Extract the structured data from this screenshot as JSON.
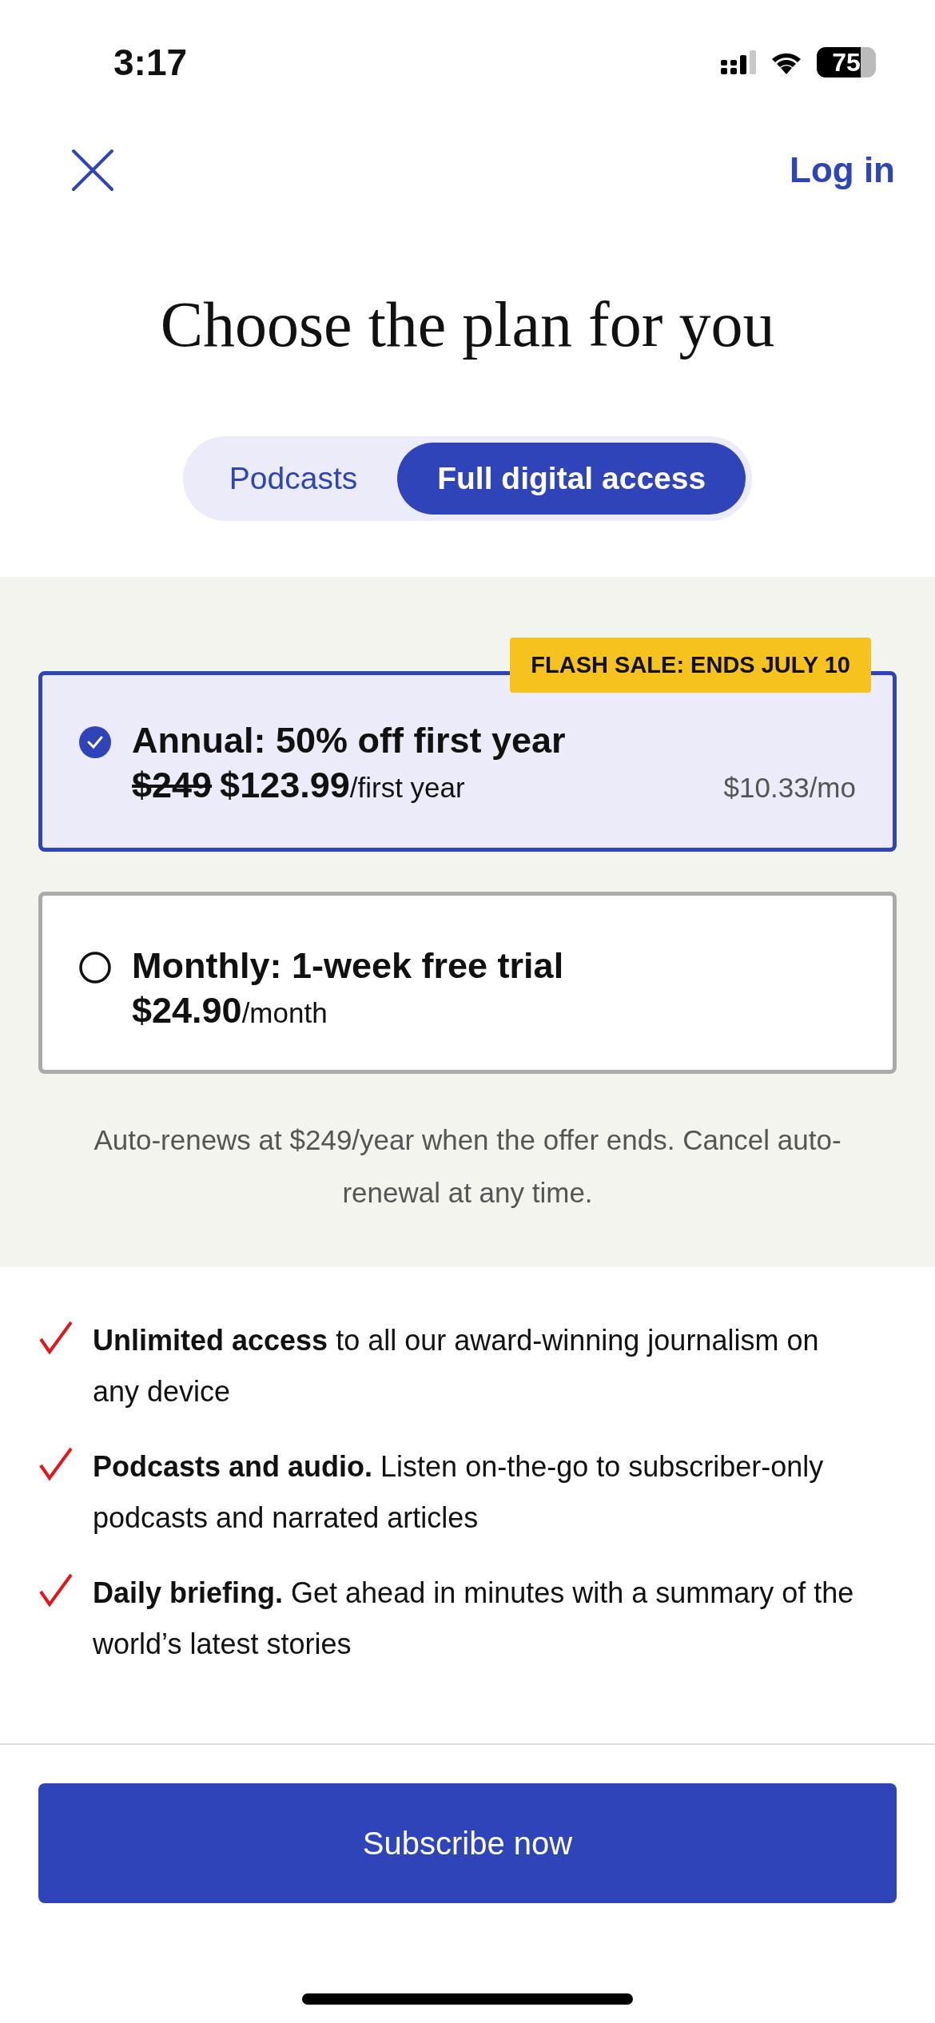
{
  "status_bar": {
    "time": "3:17",
    "battery": "75"
  },
  "header": {
    "login": "Log in"
  },
  "title": "Choose the plan for you",
  "tabs": [
    {
      "label": "Podcasts",
      "selected": false
    },
    {
      "label": "Full digital access",
      "selected": true
    }
  ],
  "plans": [
    {
      "name": "Annual: 50% off first year",
      "old_price": "$249",
      "price": "$123.99",
      "period": "/first year",
      "monthly": "$10.33/mo",
      "badge": "FLASH SALE: ENDS JULY 10",
      "selected": true
    },
    {
      "name": "Monthly: 1-week free trial",
      "price": "$24.90",
      "period": "/month",
      "selected": false
    }
  ],
  "note": "Auto-renews at $249/year when the offer ends. Cancel auto-renewal at any time.",
  "features": [
    "**Unlimited access** to all our award-winning journalism on any device",
    "**Podcasts and audio.** Listen on-the-go to subscriber-only podcasts and narrated articles",
    "**Daily briefing.** Get ahead in minutes with a summary of the world’s latest stories"
  ],
  "button": "Subscribe now"
}
